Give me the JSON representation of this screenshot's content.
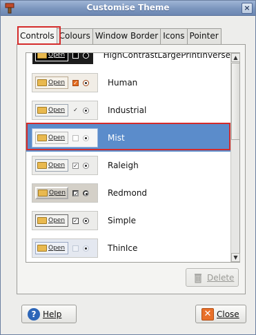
{
  "window": {
    "title": "Customise Theme",
    "close_glyph": "×"
  },
  "tabs": [
    {
      "label": "Controls",
      "active": true
    },
    {
      "label": "Colours",
      "active": false
    },
    {
      "label": "Window Border",
      "active": false
    },
    {
      "label": "Icons",
      "active": false
    },
    {
      "label": "Pointer",
      "active": false
    }
  ],
  "preview": {
    "button_label": "Open"
  },
  "themes": [
    {
      "name": "HighContrastLargePrintInverse",
      "selected": false
    },
    {
      "name": "Human",
      "selected": false
    },
    {
      "name": "Industrial",
      "selected": false
    },
    {
      "name": "Mist",
      "selected": true
    },
    {
      "name": "Raleigh",
      "selected": false
    },
    {
      "name": "Redmond",
      "selected": false
    },
    {
      "name": "Simple",
      "selected": false
    },
    {
      "name": "ThinIce",
      "selected": false
    }
  ],
  "buttons": {
    "delete_label": "Delete",
    "help_label": "Help",
    "close_label": "Close"
  },
  "colors": {
    "selection": "#5b8ccb",
    "highlight_border": "#d42a2a",
    "titlebar": "#7b95bd"
  }
}
